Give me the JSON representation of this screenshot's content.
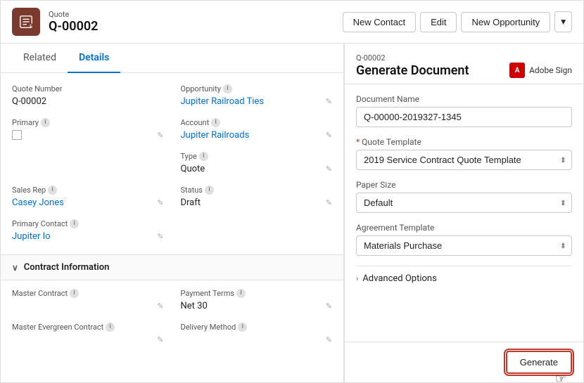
{
  "header": {
    "icon_label": "🛒",
    "subtitle": "Quote",
    "title": "Q-00002",
    "actions": {
      "new_contact": "New Contact",
      "edit": "Edit",
      "new_opportunity": "New Opportunity"
    }
  },
  "tabs": {
    "related": "Related",
    "details": "Details"
  },
  "details": {
    "quote_number_label": "Quote Number",
    "quote_number_value": "Q-00002",
    "opportunity_label": "Opportunity",
    "opportunity_value": "Jupiter Railroad Ties",
    "primary_label": "Primary",
    "account_label": "Account",
    "account_value": "Jupiter Railroads",
    "type_label": "Type",
    "type_value": "Quote",
    "sales_rep_label": "Sales Rep",
    "sales_rep_value": "Casey Jones",
    "status_label": "Status",
    "status_value": "Draft",
    "primary_contact_label": "Primary Contact",
    "primary_contact_value": "Jupiter Io"
  },
  "contract_section": {
    "label": "Contract Information",
    "master_contract_label": "Master Contract",
    "payment_terms_label": "Payment Terms",
    "payment_terms_value": "Net 30",
    "master_evergreen_label": "Master Evergreen Contract",
    "delivery_method_label": "Delivery Method"
  },
  "right_panel": {
    "subtitle": "Q-00002",
    "title": "Generate Document",
    "adobe_sign_label": "Adobe Sign",
    "document_name_label": "Document Name",
    "document_name_value": "Q-00000-2019327-1345",
    "quote_template_label": "* Quote Template",
    "quote_template_value": "2019 Service Contract Quote Template",
    "paper_size_label": "Paper Size",
    "paper_size_value": "Default",
    "agreement_template_label": "Agreement Template",
    "agreement_template_value": "Materials Purchase",
    "advanced_options_label": "Advanced Options",
    "generate_button": "Generate"
  }
}
